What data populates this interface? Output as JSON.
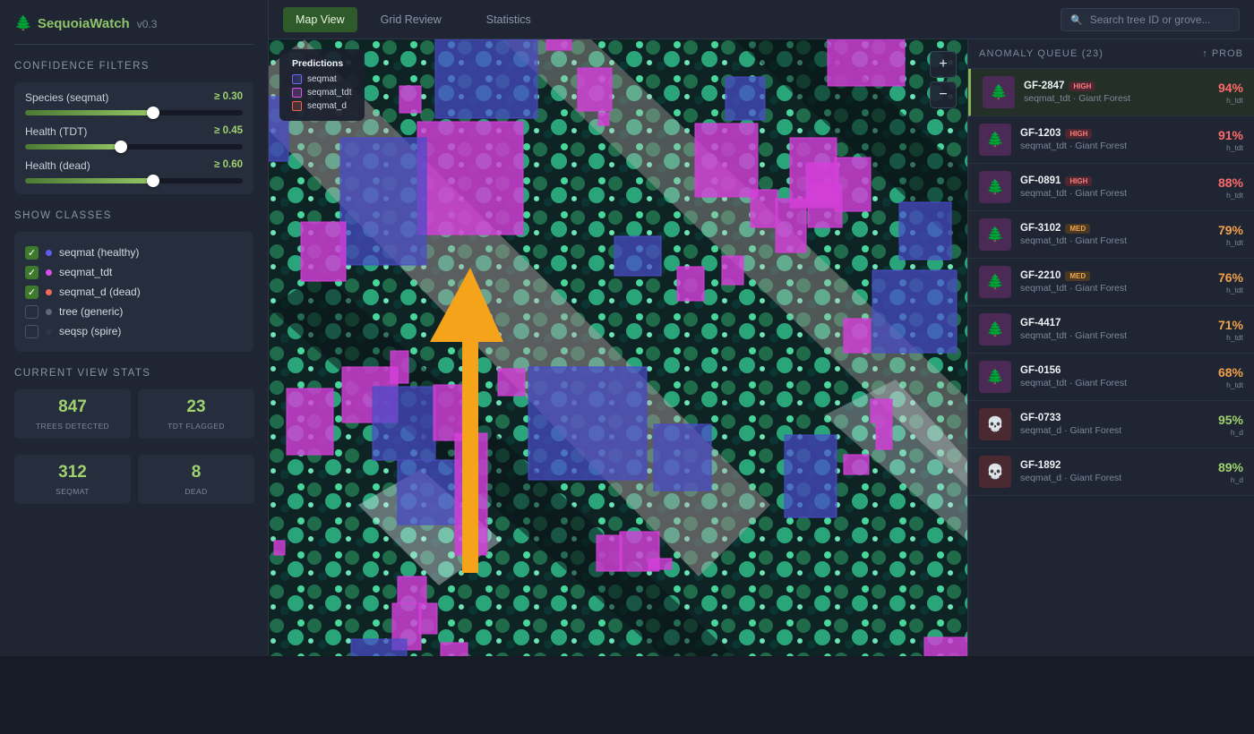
{
  "app": {
    "icon": "tree-icon",
    "name": "SequoiaWatch",
    "version": "v0.3"
  },
  "sidebar": {
    "filters_title": "CONFIDENCE FILTERS",
    "filters": [
      {
        "label": "Species (seqmat)",
        "value_text": "≥ 0.30",
        "level": 0.59
      },
      {
        "label": "Health (TDT)",
        "value_text": "≥ 0.45",
        "level": 0.44
      },
      {
        "label": "Health (dead)",
        "value_text": "≥ 0.60",
        "level": 0.59
      }
    ],
    "classes_title": "SHOW CLASSES",
    "classes": [
      {
        "label": "seqmat (healthy)",
        "checked": true,
        "color": "#5c5cf0"
      },
      {
        "label": "seqmat_tdt",
        "checked": true,
        "color": "#d84fe8"
      },
      {
        "label": "seqmat_d (dead)",
        "checked": true,
        "color": "#ef6b55"
      },
      {
        "label": "tree (generic)",
        "checked": false,
        "color": "#5f6777"
      },
      {
        "label": "seqsp (spire)",
        "checked": false,
        "color": "#2e3545"
      }
    ],
    "stats_title": "CURRENT VIEW STATS",
    "stats": [
      {
        "value": "847",
        "label": "TREES DETECTED"
      },
      {
        "value": "23",
        "label": "TDT FLAGGED"
      },
      {
        "value": "312",
        "label": "SEQMAT"
      },
      {
        "value": "8",
        "label": "DEAD"
      }
    ]
  },
  "topbar": {
    "tabs": [
      "Map View",
      "Grid Review",
      "Statistics"
    ],
    "active_tab": 0,
    "search_placeholder": "Search tree ID or grove..."
  },
  "map": {
    "legend_title": "Predictions",
    "legend": [
      {
        "label": "seqmat",
        "color": "#6a6af7"
      },
      {
        "label": "seqmat_tdt",
        "color": "#dd55ee"
      },
      {
        "label": "seqmat_d",
        "color": "#f0644d"
      }
    ],
    "zoom_in": "+",
    "zoom_out": "−"
  },
  "queue": {
    "title": "ANOMALY QUEUE (23)",
    "sort_label": "↑ PROB",
    "items": [
      {
        "id": "GF-2847",
        "badge": "HIGH",
        "sub": "seqmat_tdt · Giant Forest",
        "pct": "94%",
        "cls": "h_tdt",
        "kind": "tdt",
        "pct_color": "#ff6b6b",
        "selected": true
      },
      {
        "id": "GF-1203",
        "badge": "HIGH",
        "sub": "seqmat_tdt · Giant Forest",
        "pct": "91%",
        "cls": "h_tdt",
        "kind": "tdt",
        "pct_color": "#ff6b6b"
      },
      {
        "id": "GF-0891",
        "badge": "HIGH",
        "sub": "seqmat_tdt · Giant Forest",
        "pct": "88%",
        "cls": "h_tdt",
        "kind": "tdt",
        "pct_color": "#ff6b6b"
      },
      {
        "id": "GF-3102",
        "badge": "MED",
        "sub": "seqmat_tdt · Giant Forest",
        "pct": "79%",
        "cls": "h_tdt",
        "kind": "tdt",
        "pct_color": "#f2a24a"
      },
      {
        "id": "GF-2210",
        "badge": "MED",
        "sub": "seqmat_tdt · Giant Forest",
        "pct": "76%",
        "cls": "h_tdt",
        "kind": "tdt",
        "pct_color": "#f2a24a"
      },
      {
        "id": "GF-4417",
        "badge": "",
        "sub": "seqmat_tdt · Giant Forest",
        "pct": "71%",
        "cls": "h_tdt",
        "kind": "tdt",
        "pct_color": "#f2a24a"
      },
      {
        "id": "GF-0156",
        "badge": "",
        "sub": "seqmat_tdt · Giant Forest",
        "pct": "68%",
        "cls": "h_tdt",
        "kind": "tdt",
        "pct_color": "#f2a24a"
      },
      {
        "id": "GF-0733",
        "badge": "",
        "sub": "seqmat_d · Giant Forest",
        "pct": "95%",
        "cls": "h_d",
        "kind": "dead",
        "pct_color": "#9fd26f"
      },
      {
        "id": "GF-1892",
        "badge": "",
        "sub": "seqmat_d · Giant Forest",
        "pct": "89%",
        "cls": "h_d",
        "kind": "dead",
        "pct_color": "#9fd26f"
      }
    ]
  }
}
